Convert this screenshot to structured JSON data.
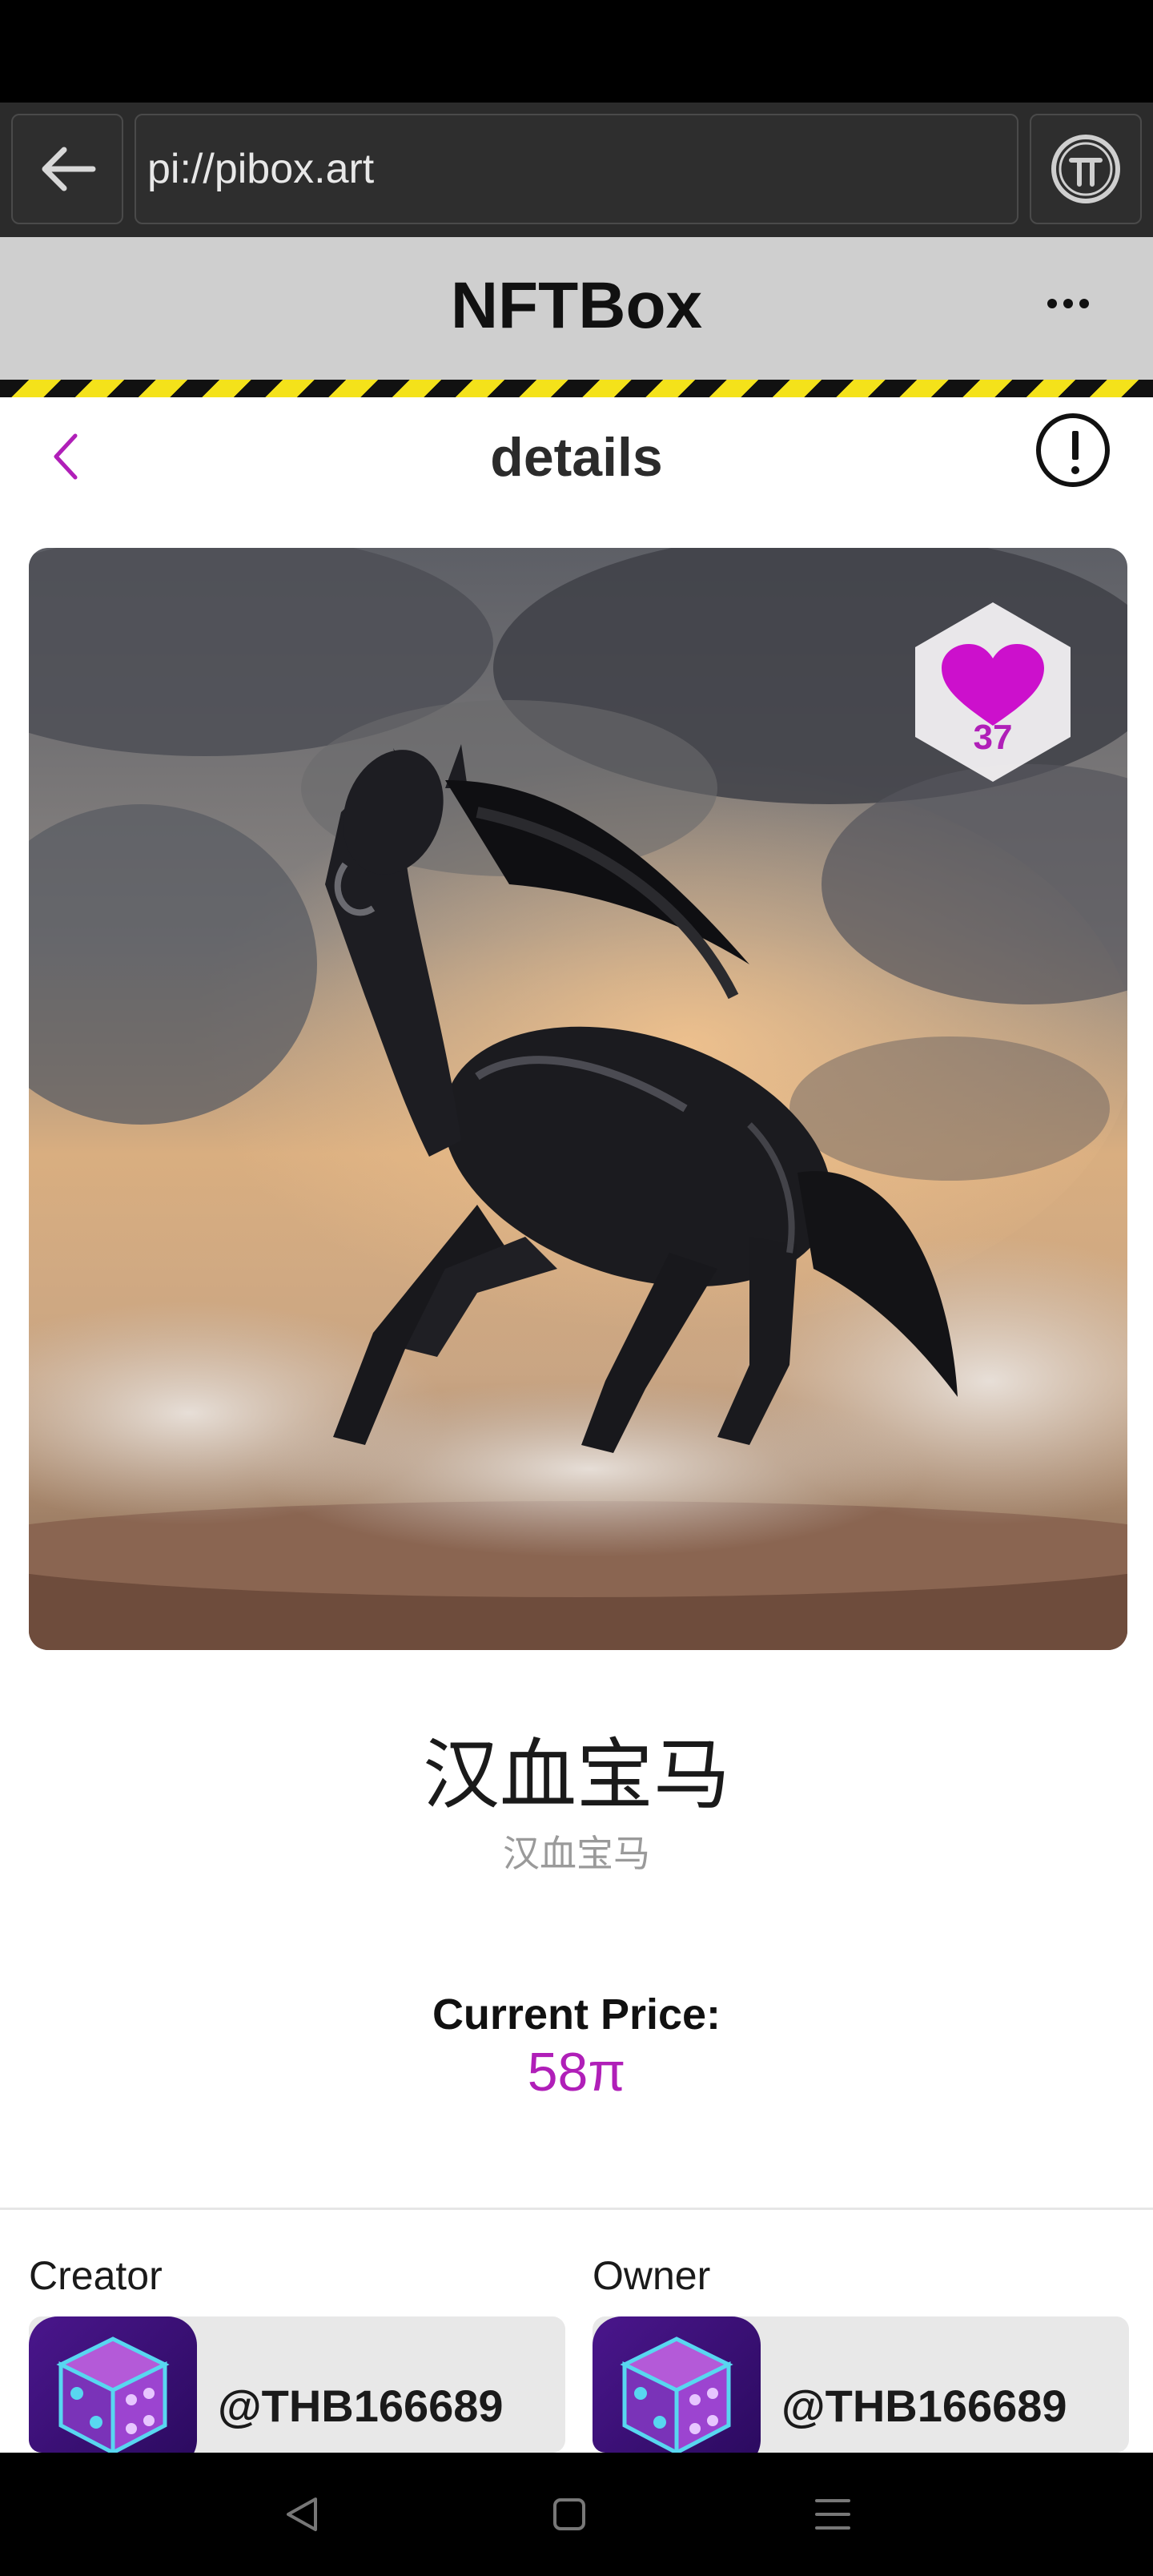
{
  "browser": {
    "url": "pi://pibox.art",
    "back_icon": "arrow-left-icon",
    "pi_icon": "pi-logo-icon"
  },
  "app": {
    "title": "NFTBox",
    "menu_icon": "more-dots-icon"
  },
  "details": {
    "title": "details",
    "back_icon": "chevron-left-icon",
    "report_icon": "exclamation-circle-icon"
  },
  "artwork": {
    "likes": "37",
    "like_icon": "heart-icon"
  },
  "nft": {
    "title": "汉血宝马",
    "subtitle": "汉血宝马",
    "price_label": "Current Price:",
    "price": "58π"
  },
  "creator": {
    "label": "Creator",
    "username": "@THB166689"
  },
  "owner": {
    "label": "Owner",
    "username": "@THB166689"
  },
  "colors": {
    "accent": "#b01fb8",
    "header_bg": "#cfcfcf",
    "browser_bg": "#2b2b2b"
  }
}
